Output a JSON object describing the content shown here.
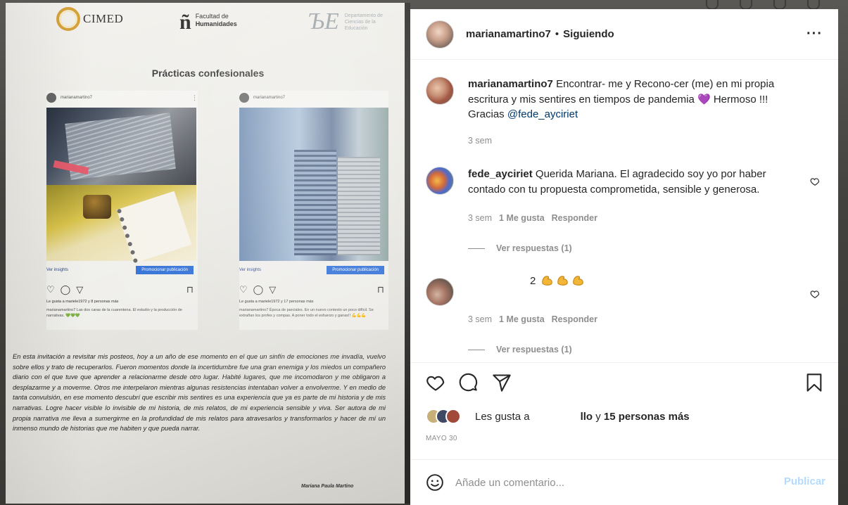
{
  "poster": {
    "logo_cimed": "CIMED",
    "logo_fh_line1": "Facultad de",
    "logo_fh_line2": "Humanidades",
    "logo_dce_line1": "Departamento de",
    "logo_dce_line2": "Ciencias de la",
    "logo_dce_line3": "Educación",
    "title": "Prácticas confesionales",
    "post1": {
      "username": "marianamartino7",
      "insights": "Ver insights",
      "promote": "Promocionar publicación",
      "likes": "Le gusta a mariele1972 y 8 personas más",
      "caption": "marianamartino7 Las dos caras de la cuarentena. El estudio y la producción de narrativas. 💚💚💚"
    },
    "post2": {
      "username": "marianamartino7",
      "insights": "Ver insights",
      "promote": "Promocionar publicación",
      "likes": "Le gusta a mariele1972 y 17 personas más",
      "caption": "marianamartino7 Época de parciales. En un nuevo contexto un poco difícil. Se extrañan los profes y compas. A poner todo el esfuerzo y ganas!! 💪💪💪"
    },
    "body": "En esta invitación a revisitar mis posteos, hoy a un año de ese momento en el que un sinfín de emociones me invadía, vuelvo sobre ellos y trato de recuperarlos. Fueron momentos donde la incertidumbre fue una gran enemiga y los miedos un compañero diario con el que tuve que aprender a relacionarme desde otro lugar. Habité lugares, que me incomodaron y me obligaron a desplazarme y a moverme. Otros me interpelaron mientras algunas resistencias intentaban volver a envolverme. Y en medio de tanta convulsión, en ese momento descubrí que escribir mis sentires es una experiencia que ya es parte de mi historia y de mis narrativas. Logre hacer visible lo invisible de mi historia, de mis relatos, de mi experiencia sensible y viva. Ser autora de mi propia narrativa me lleva a sumergirme en la profundidad de mis relatos para atravesarlos y transformarlos y hacer de mí un inmenso mundo de historias que me habiten y que pueda narrar.",
    "signature": "Mariana Paula Martino"
  },
  "header": {
    "username": "marianamartino7",
    "separator": "•",
    "follow_state": "Siguiendo",
    "more": "···"
  },
  "comments": [
    {
      "username": "marianamartino7",
      "text": "Encontrar- me y Recono-cer (me) en mi propia escritura y mis sentires en tiempos de pandemia 💜 Hermoso !!! Gracias",
      "mention": "@fede_ayciriet",
      "time": "3 sem"
    },
    {
      "username": "fede_ayciriet",
      "text": "Querida Mariana. El agradecido soy yo por haber contado con tu propuesta comprometida, sensible y generosa.",
      "time": "3 sem",
      "likes": "1 Me gusta",
      "reply": "Responder",
      "view_replies": "Ver respuestas (1)"
    },
    {
      "username": "",
      "text": "2",
      "time": "3 sem",
      "likes": "1 Me gusta",
      "reply": "Responder",
      "view_replies": "Ver respuestas (1)"
    }
  ],
  "likes_row": {
    "prefix": "Les gusta a",
    "suffix_user": "llo",
    "suffix_rest": "y",
    "others": "15 personas más"
  },
  "date": "MAYO 30",
  "add_comment": {
    "placeholder": "Añade un comentario...",
    "publish": "Publicar"
  },
  "icons": {
    "like": "heart-outline-icon",
    "comment": "speech-bubble-icon",
    "share": "paper-plane-icon",
    "save": "bookmark-icon",
    "emoji": "smiley-face-icon"
  },
  "colors": {
    "text": "#262626",
    "secondary": "#8e8e8e",
    "link": "#00376b",
    "publish_disabled": "#b3dbff",
    "promote_button": "#2f6fd6"
  }
}
